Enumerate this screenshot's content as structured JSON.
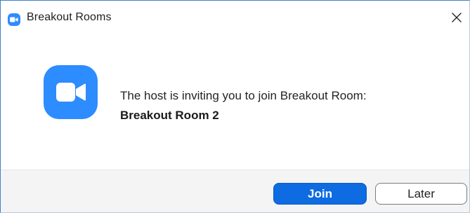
{
  "window": {
    "title": "Breakout Rooms",
    "icon": "zoom-camera-icon",
    "close_icon": "close-icon"
  },
  "dialog": {
    "message": "The host is inviting you to join Breakout Room:",
    "room_name": "Breakout Room 2",
    "icon": "zoom-app-icon"
  },
  "buttons": {
    "join_label": "Join",
    "later_label": "Later"
  },
  "colors": {
    "brand_blue": "#2d8cff",
    "primary_button": "#0e6be1",
    "footer_bg": "#f4f4f5"
  }
}
